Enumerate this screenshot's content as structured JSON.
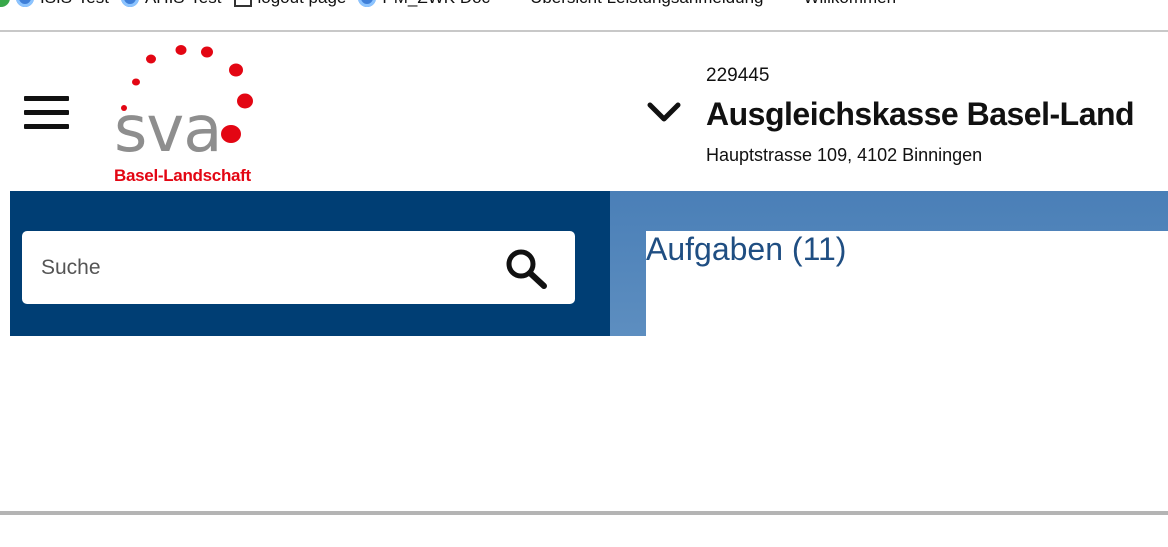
{
  "bookmarks": [
    {
      "label": "ISIS-Test",
      "icon": "ie-icon"
    },
    {
      "label": "AHIS-Test",
      "icon": "ie-icon"
    },
    {
      "label": "logout page",
      "icon": "page-icon"
    },
    {
      "label": "PM_ZWK Doc",
      "icon": "ie-icon"
    },
    {
      "label": "Ubersicht Leistungsanmeldung",
      "icon": "sva-icon"
    },
    {
      "label": "Willkommen",
      "icon": "sva-icon"
    }
  ],
  "header": {
    "menu_icon": "hamburger-menu-icon",
    "logo": {
      "wordmark": "sva",
      "subtitle": "Basel-Landschaft",
      "brand_red": "#e30613",
      "brand_grey": "#8e8e8e"
    },
    "org_switch_icon": "chevron-down-icon",
    "org_id": "229445",
    "org_name": "Ausgleichskasse Basel-Land",
    "org_address": "Hauptstrasse 109, 4102 Binningen"
  },
  "sidebar": {
    "search": {
      "placeholder": "Suche",
      "value": "",
      "icon": "search-icon"
    },
    "background": "#003e74"
  },
  "main": {
    "tasks_title": "Aufgaben (11)",
    "title_color": "#1f4e82",
    "background": "#5a8bbf"
  }
}
